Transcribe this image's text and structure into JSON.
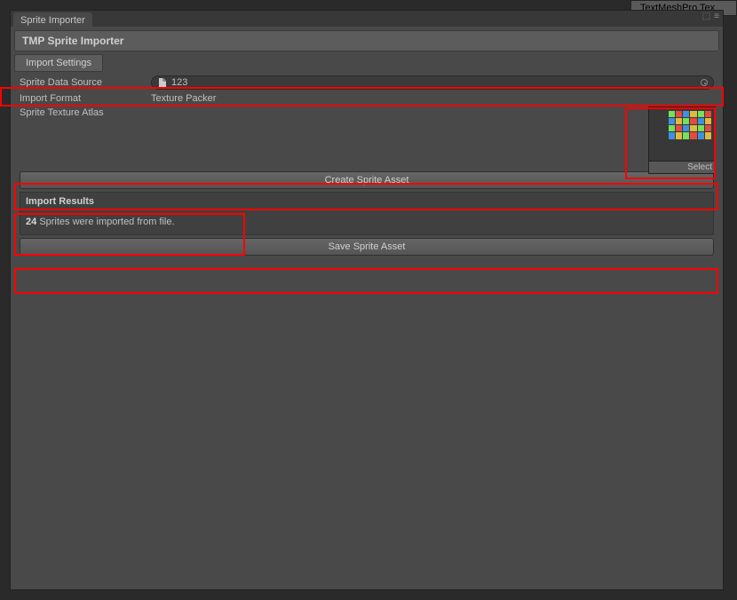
{
  "bg_tab": "TextMeshPro Tex",
  "window": {
    "tab": "Sprite Importer",
    "title": "TMP Sprite Importer"
  },
  "section_header": "Import Settings",
  "fields": {
    "data_source_label": "Sprite Data Source",
    "data_source_value": "123",
    "import_format_label": "Import Format",
    "import_format_value": "Texture Packer",
    "texture_atlas_label": "Sprite Texture Atlas",
    "texture_select": "Select"
  },
  "buttons": {
    "create": "Create Sprite Asset",
    "save": "Save Sprite Asset"
  },
  "results": {
    "title": "Import Results",
    "count": "24",
    "message": "Sprites were imported from file."
  }
}
